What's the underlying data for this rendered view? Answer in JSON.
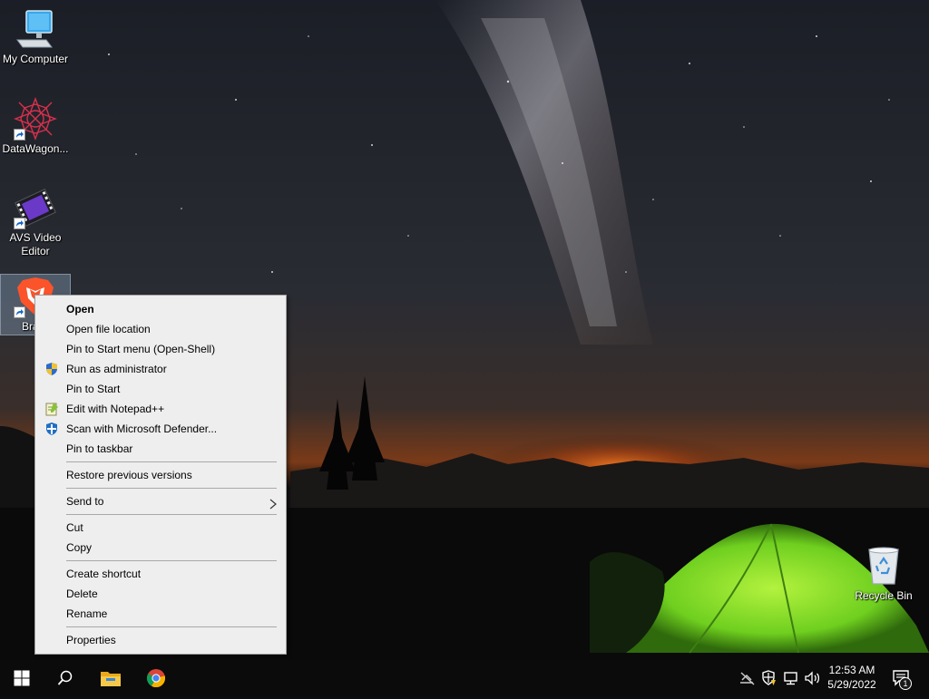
{
  "desktop": {
    "icons": [
      {
        "label": "My Computer",
        "icon": "computer-icon"
      },
      {
        "label": "DataWagon...",
        "icon": "datawagon-icon"
      },
      {
        "label": "AVS Video Editor",
        "icon": "video-editor-icon"
      },
      {
        "label": "Bra",
        "icon": "brave-icon",
        "selected": true
      },
      {
        "label": "Recycle Bin",
        "icon": "recycle-bin-icon"
      }
    ]
  },
  "context_menu": {
    "items": [
      {
        "label": "Open",
        "bold": true
      },
      {
        "label": "Open file location"
      },
      {
        "label": "Pin to Start menu (Open-Shell)"
      },
      {
        "label": "Run as administrator",
        "icon": "shield-icon"
      },
      {
        "label": "Pin to Start"
      },
      {
        "label": "Edit with Notepad++",
        "icon": "notepad-plus-plus-icon"
      },
      {
        "label": "Scan with Microsoft Defender...",
        "icon": "defender-icon"
      },
      {
        "label": "Pin to taskbar"
      },
      {
        "label": "Restore previous versions"
      },
      {
        "label": "Send to",
        "submenu": true
      },
      {
        "label": "Cut"
      },
      {
        "label": "Copy"
      },
      {
        "label": "Create shortcut"
      },
      {
        "label": "Delete"
      },
      {
        "label": "Rename"
      },
      {
        "label": "Properties"
      }
    ]
  },
  "taskbar": {
    "pinned": [
      {
        "icon": "windows-start-icon"
      },
      {
        "icon": "search-icon"
      },
      {
        "icon": "file-explorer-icon"
      },
      {
        "icon": "chrome-icon"
      }
    ],
    "tray": [
      {
        "icon": "network-disconnected-icon"
      },
      {
        "icon": "security-warning-icon"
      },
      {
        "icon": "network-icon"
      },
      {
        "icon": "volume-icon"
      }
    ],
    "clock": {
      "time": "12:53 AM",
      "date": "5/29/2022"
    },
    "notifications": {
      "icon": "action-center-icon",
      "count": "1"
    }
  },
  "colors": {
    "menu_bg": "#eeeeee",
    "taskbar_bg": "#0b0b0b",
    "tent_green": "#7ddc2c",
    "horizon_glow": "#e0641c"
  }
}
